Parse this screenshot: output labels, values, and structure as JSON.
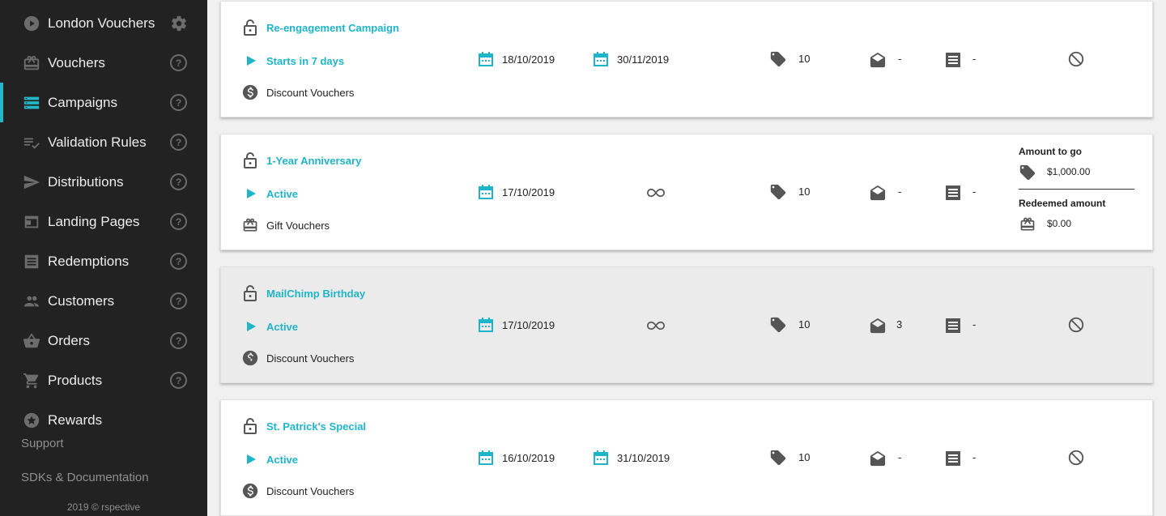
{
  "sidebar": {
    "project": "London Vouchers",
    "items": [
      {
        "label": "Vouchers",
        "icon": "gift-icon"
      },
      {
        "label": "Campaigns",
        "icon": "campaigns-icon"
      },
      {
        "label": "Validation Rules",
        "icon": "validation-icon"
      },
      {
        "label": "Distributions",
        "icon": "send-icon"
      },
      {
        "label": "Landing Pages",
        "icon": "landing-page-icon"
      },
      {
        "label": "Redemptions",
        "icon": "receipt-icon"
      },
      {
        "label": "Customers",
        "icon": "people-icon"
      },
      {
        "label": "Orders",
        "icon": "basket-icon"
      },
      {
        "label": "Products",
        "icon": "cart-icon"
      },
      {
        "label": "Rewards",
        "icon": "star-icon"
      }
    ],
    "help_glyph": "?",
    "support": "Support",
    "docs": "SDKs & Documentation",
    "copyright": "2019 © rspective",
    "accent": "#22b8c8"
  },
  "campaigns": [
    {
      "name": "Re-engagement Campaign",
      "status": "Starts in 7 days",
      "start": "18/10/2019",
      "end": "30/11/2019",
      "type": "Discount Vouchers",
      "type_icon": "dollar-icon",
      "vouchers": "10",
      "distributions": "-",
      "redemptions": "-"
    },
    {
      "name": "1-Year Anniversary",
      "status": "Active",
      "start": "17/10/2019",
      "end": null,
      "type": "Gift Vouchers",
      "type_icon": "gift-icon",
      "vouchers": "10",
      "distributions": "-",
      "redemptions": "-",
      "amount_to_go_label": "Amount to go",
      "amount_to_go": "$1,000.00",
      "redeemed_amount_label": "Redeemed amount",
      "redeemed_amount": "$0.00"
    },
    {
      "name": "MailChimp Birthday",
      "status": "Active",
      "start": "17/10/2019",
      "end": null,
      "type": "Discount Vouchers",
      "type_icon": "dollar-icon",
      "vouchers": "10",
      "distributions": "3",
      "redemptions": "-"
    },
    {
      "name": "St. Patrick's Special",
      "status": "Active",
      "start": "16/10/2019",
      "end": "31/10/2019",
      "type": "Discount Vouchers",
      "type_icon": "dollar-icon",
      "vouchers": "10",
      "distributions": "-",
      "redemptions": "-"
    }
  ],
  "colors": {
    "accent": "#1fb5c8",
    "sidebar_bg": "#222222",
    "icon_gray": "#555555"
  }
}
